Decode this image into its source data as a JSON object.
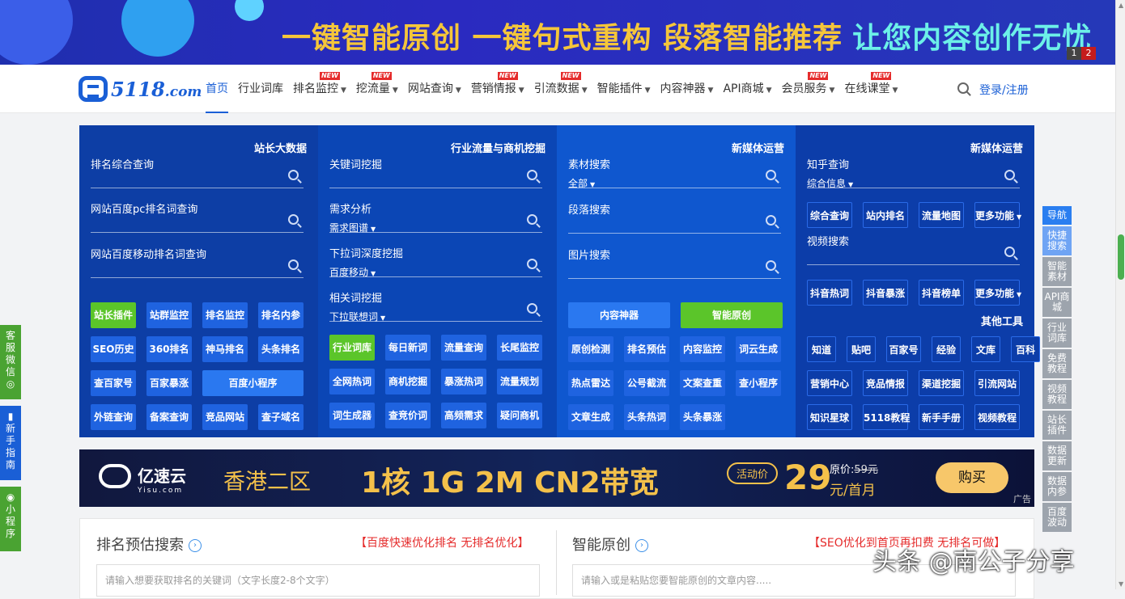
{
  "banner": {
    "text_yellow": "一键智能原创 一键句式重构 段落智能推荐",
    "text_cyan": "让您内容创作无忧",
    "pages": [
      "1",
      "2"
    ]
  },
  "logo": {
    "text": "5118",
    "suffix": ".com"
  },
  "nav": {
    "items": [
      {
        "label": "首页",
        "active": true,
        "caret": false,
        "new": false
      },
      {
        "label": "行业词库",
        "caret": false,
        "new": false
      },
      {
        "label": "排名监控",
        "caret": true,
        "new": true
      },
      {
        "label": "挖流量",
        "caret": true,
        "new": true
      },
      {
        "label": "网站查询",
        "caret": true,
        "new": false
      },
      {
        "label": "营销情报",
        "caret": true,
        "new": true
      },
      {
        "label": "引流数据",
        "caret": true,
        "new": true
      },
      {
        "label": "智能插件",
        "caret": true,
        "new": false
      },
      {
        "label": "内容神器",
        "caret": true,
        "new": false
      },
      {
        "label": "API商城",
        "caret": true,
        "new": false
      },
      {
        "label": "会员服务",
        "caret": true,
        "new": true
      },
      {
        "label": "在线课堂",
        "caret": true,
        "new": true
      }
    ],
    "new_badge": "NEW",
    "login": "登录/注册"
  },
  "panel": {
    "col1": {
      "title": "站长大数据",
      "fields": [
        "排名综合查询",
        "网站百度pc排名词查询",
        "网站百度移动排名词查询"
      ],
      "buttons": [
        [
          "站长插件",
          "站群监控",
          "排名监控",
          "排名内参"
        ],
        [
          "SEO历史",
          "360排名",
          "神马排名",
          "头条排名"
        ],
        [
          "查百家号",
          "百家暴涨",
          "百度小程序"
        ],
        [
          "外链查询",
          "备案查询",
          "竞品网站",
          "查子域名"
        ]
      ]
    },
    "col2": {
      "title": "行业流量与商机挖掘",
      "fields": [
        {
          "label": "关键词挖掘",
          "sub": ""
        },
        {
          "label": "需求分析",
          "sub": "需求图谱"
        },
        {
          "label": "下拉词深度挖掘",
          "sub": "百度移动"
        },
        {
          "label": "相关词挖掘",
          "sub": "下拉联想词"
        }
      ],
      "buttons": [
        [
          "行业词库",
          "每日新词",
          "流量查询",
          "长尾监控"
        ],
        [
          "全网热词",
          "商机挖掘",
          "暴涨热词",
          "流量规划"
        ],
        [
          "词生成器",
          "查竞价词",
          "高频需求",
          "疑问商机"
        ]
      ]
    },
    "col3": {
      "title": "新媒体运营",
      "fields": [
        {
          "label": "素材搜索",
          "sub": "全部"
        },
        {
          "label": "段落搜索",
          "sub": ""
        },
        {
          "label": "图片搜索",
          "sub": ""
        }
      ],
      "big_buttons": [
        "内容神器",
        "智能原创"
      ],
      "buttons": [
        [
          "原创检测",
          "排名预估",
          "内容监控",
          "词云生成"
        ],
        [
          "热点雷达",
          "公号截流",
          "文案查重",
          "查小程序"
        ],
        [
          "文章生成",
          "头条热词",
          "头条暴涨"
        ]
      ]
    },
    "col4": {
      "title": "新媒体运营",
      "field1": {
        "label": "知乎查询",
        "sub": "综合信息"
      },
      "row1": [
        "综合查询",
        "站内排名",
        "流量地图",
        "更多功能"
      ],
      "field2": {
        "label": "视频搜索"
      },
      "row2": [
        "抖音热词",
        "抖音暴涨",
        "抖音榜单",
        "更多功能"
      ],
      "other_title": "其他工具",
      "other": [
        [
          "知道",
          "贴吧",
          "百家号",
          "经验",
          "文库",
          "百科"
        ],
        [
          "营销中心",
          "竞品情报",
          "渠道挖掘",
          "引流网站"
        ],
        [
          "知识星球",
          "5118教程",
          "新手手册",
          "视频教程"
        ]
      ]
    }
  },
  "promo": {
    "brand": "亿速云",
    "brand_sub": "Yisu.com",
    "region": "香港二区",
    "spec": "1核 1G 2M CN2带宽",
    "tag": "活动价",
    "price": "29",
    "orig_label": "原价:",
    "orig_price": "59元",
    "per": "元/首月",
    "buy": "购买",
    "ad": "广告"
  },
  "cards": {
    "left": {
      "title": "排名预估搜索",
      "red": "【百度快速优化排名 无排名优化】",
      "placeholder": "请输入想要获取排名的关键词（文字长度2-8个文字）"
    },
    "right": {
      "title": "智能原创",
      "red": "【SEO优化到首页再扣费 无排名可做】",
      "placeholder": "请输入或是粘贴您要智能原创的文章内容....."
    }
  },
  "watermark": "头条 @南公子分享",
  "left_side": [
    "客服微信",
    "新手指南",
    "小程序"
  ],
  "right_side": [
    "导航",
    "快捷搜索",
    "智能素材",
    "API商城",
    "行业词库",
    "免费教程",
    "视频教程",
    "站长插件",
    "数据更新",
    "数据内参",
    "百度波动"
  ]
}
